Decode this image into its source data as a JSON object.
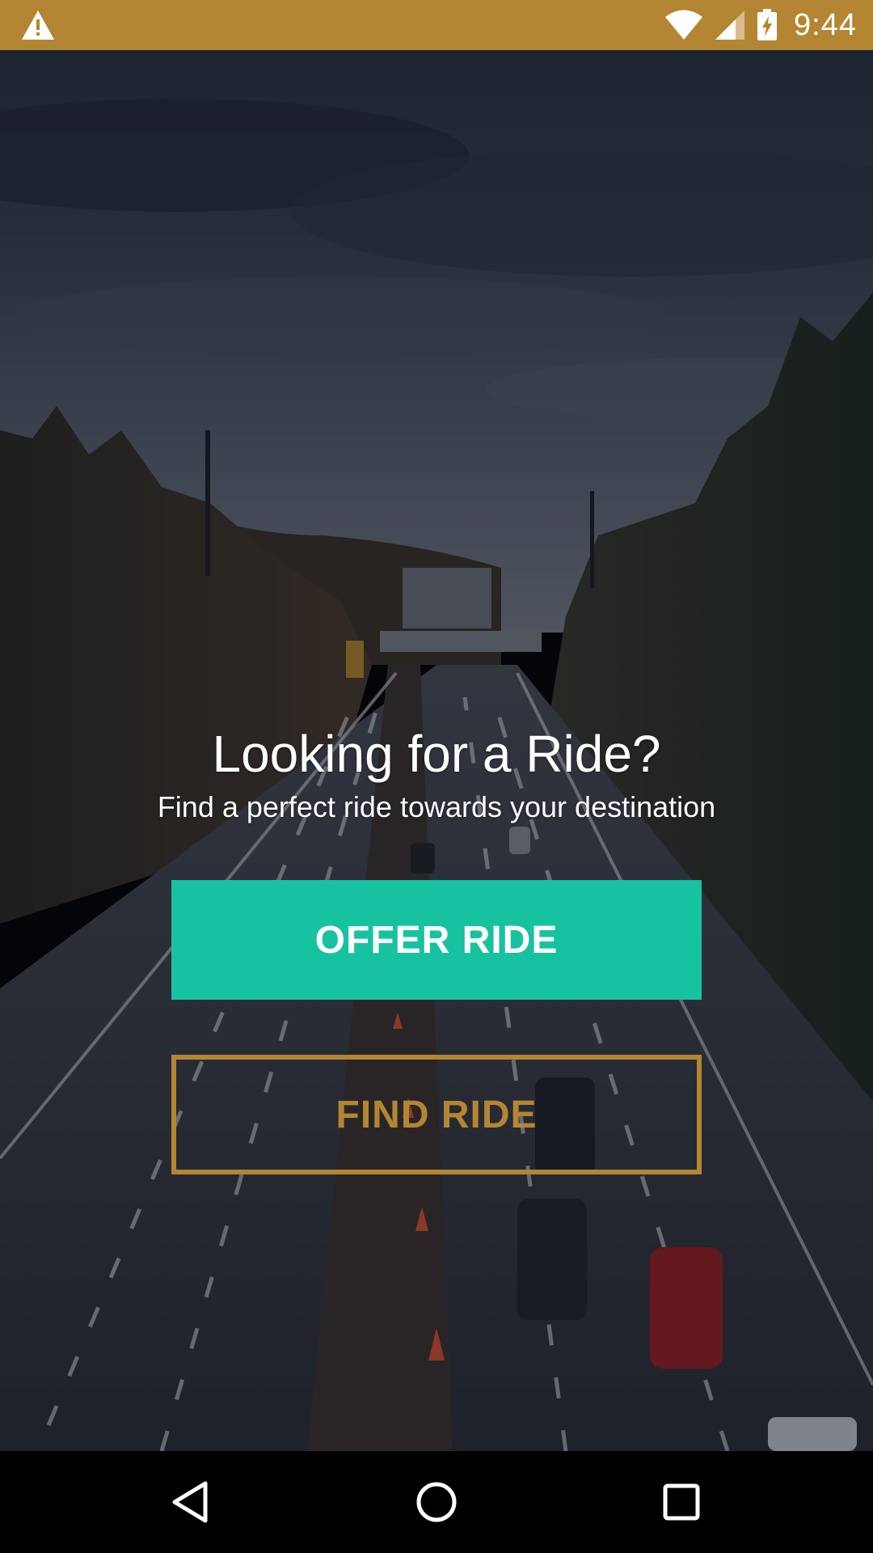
{
  "status_bar": {
    "time": "9:44",
    "icons": [
      "warning-icon",
      "wifi-icon",
      "cell-signal-icon",
      "battery-charging-icon"
    ],
    "background_color": "#b48633"
  },
  "hero": {
    "title": "Looking for a Ride?",
    "subtitle": "Find a perfect ride towards your destination"
  },
  "actions": {
    "offer_ride_label": "OFFER RIDE",
    "offer_ride_color": "#17c2a0",
    "find_ride_label": "FIND RIDE",
    "find_ride_color": "#b48633"
  },
  "nav_bar": {
    "icons": [
      "back-icon",
      "home-icon",
      "recents-icon"
    ]
  }
}
